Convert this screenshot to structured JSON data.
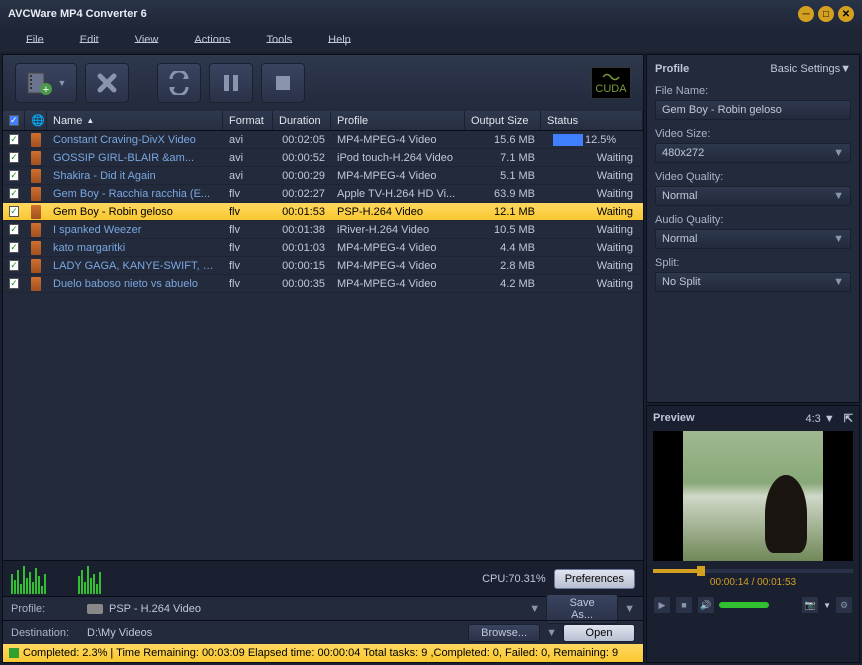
{
  "app": {
    "title": "AVCWare MP4 Converter 6"
  },
  "menu": {
    "file": "File",
    "edit": "Edit",
    "view": "View",
    "actions": "Actions",
    "tools": "Tools",
    "help": "Help"
  },
  "cuda": "CUDA",
  "columns": {
    "name": "Name",
    "format": "Format",
    "duration": "Duration",
    "profile": "Profile",
    "output": "Output Size",
    "status": "Status"
  },
  "files": [
    {
      "name": "Constant Craving-DivX Video",
      "format": "avi",
      "duration": "00:02:05",
      "profile": "MP4-MPEG-4 Video",
      "output": "15.6 MB",
      "status": "12.5%",
      "progress": true
    },
    {
      "name": "GOSSIP GIRL-BLAIR &amp;am...",
      "format": "avi",
      "duration": "00:00:52",
      "profile": "iPod touch-H.264 Video",
      "output": "7.1 MB",
      "status": "Waiting"
    },
    {
      "name": "Shakira - Did it Again",
      "format": "avi",
      "duration": "00:00:29",
      "profile": "MP4-MPEG-4 Video",
      "output": "5.1 MB",
      "status": "Waiting"
    },
    {
      "name": "Gem Boy - Racchia racchia (E...",
      "format": "flv",
      "duration": "00:02:27",
      "profile": "Apple TV-H.264 HD Vi...",
      "output": "63.9 MB",
      "status": "Waiting"
    },
    {
      "name": "Gem Boy - Robin geloso",
      "format": "flv",
      "duration": "00:01:53",
      "profile": "PSP-H.264 Video",
      "output": "12.1 MB",
      "status": "Waiting",
      "selected": true
    },
    {
      "name": "I spanked Weezer",
      "format": "flv",
      "duration": "00:01:38",
      "profile": "iRiver-H.264 Video",
      "output": "10.5 MB",
      "status": "Waiting"
    },
    {
      "name": "kato margaritki",
      "format": "flv",
      "duration": "00:01:03",
      "profile": "MP4-MPEG-4 Video",
      "output": "4.4 MB",
      "status": "Waiting"
    },
    {
      "name": "LADY GAGA, KANYE-SWIFT, B...",
      "format": "flv",
      "duration": "00:00:15",
      "profile": "MP4-MPEG-4 Video",
      "output": "2.8 MB",
      "status": "Waiting"
    },
    {
      "name": "Duelo baboso nieto vs abuelo",
      "format": "flv",
      "duration": "00:00:35",
      "profile": "MP4-MPEG-4 Video",
      "output": "4.2 MB",
      "status": "Waiting"
    }
  ],
  "cpu": {
    "label": "CPU:70.31%",
    "prefs": "Preferences"
  },
  "bottom": {
    "profile_lbl": "Profile:",
    "profile_val": "PSP - H.264 Video",
    "saveas": "Save As...",
    "dest_lbl": "Destination:",
    "dest_val": "D:\\My Videos",
    "browse": "Browse...",
    "open": "Open"
  },
  "statusbar": "Completed: 2.3% | Time Remaining: 00:03:09 Elapsed time: 00:00:04 Total tasks: 9 ,Completed: 0, Failed: 0, Remaining: 9",
  "profile": {
    "hdr": "Profile",
    "basic": "Basic Settings▼",
    "filename_lbl": "File Name:",
    "filename": "Gem Boy - Robin geloso",
    "videosize_lbl": "Video Size:",
    "videosize": "480x272",
    "videoquality_lbl": "Video Quality:",
    "videoquality": "Normal",
    "audioquality_lbl": "Audio Quality:",
    "audioquality": "Normal",
    "split_lbl": "Split:",
    "split": "No Split"
  },
  "preview": {
    "hdr": "Preview",
    "aspect": "4:3 ▼",
    "time": "00:00:14 / 00:01:53"
  }
}
